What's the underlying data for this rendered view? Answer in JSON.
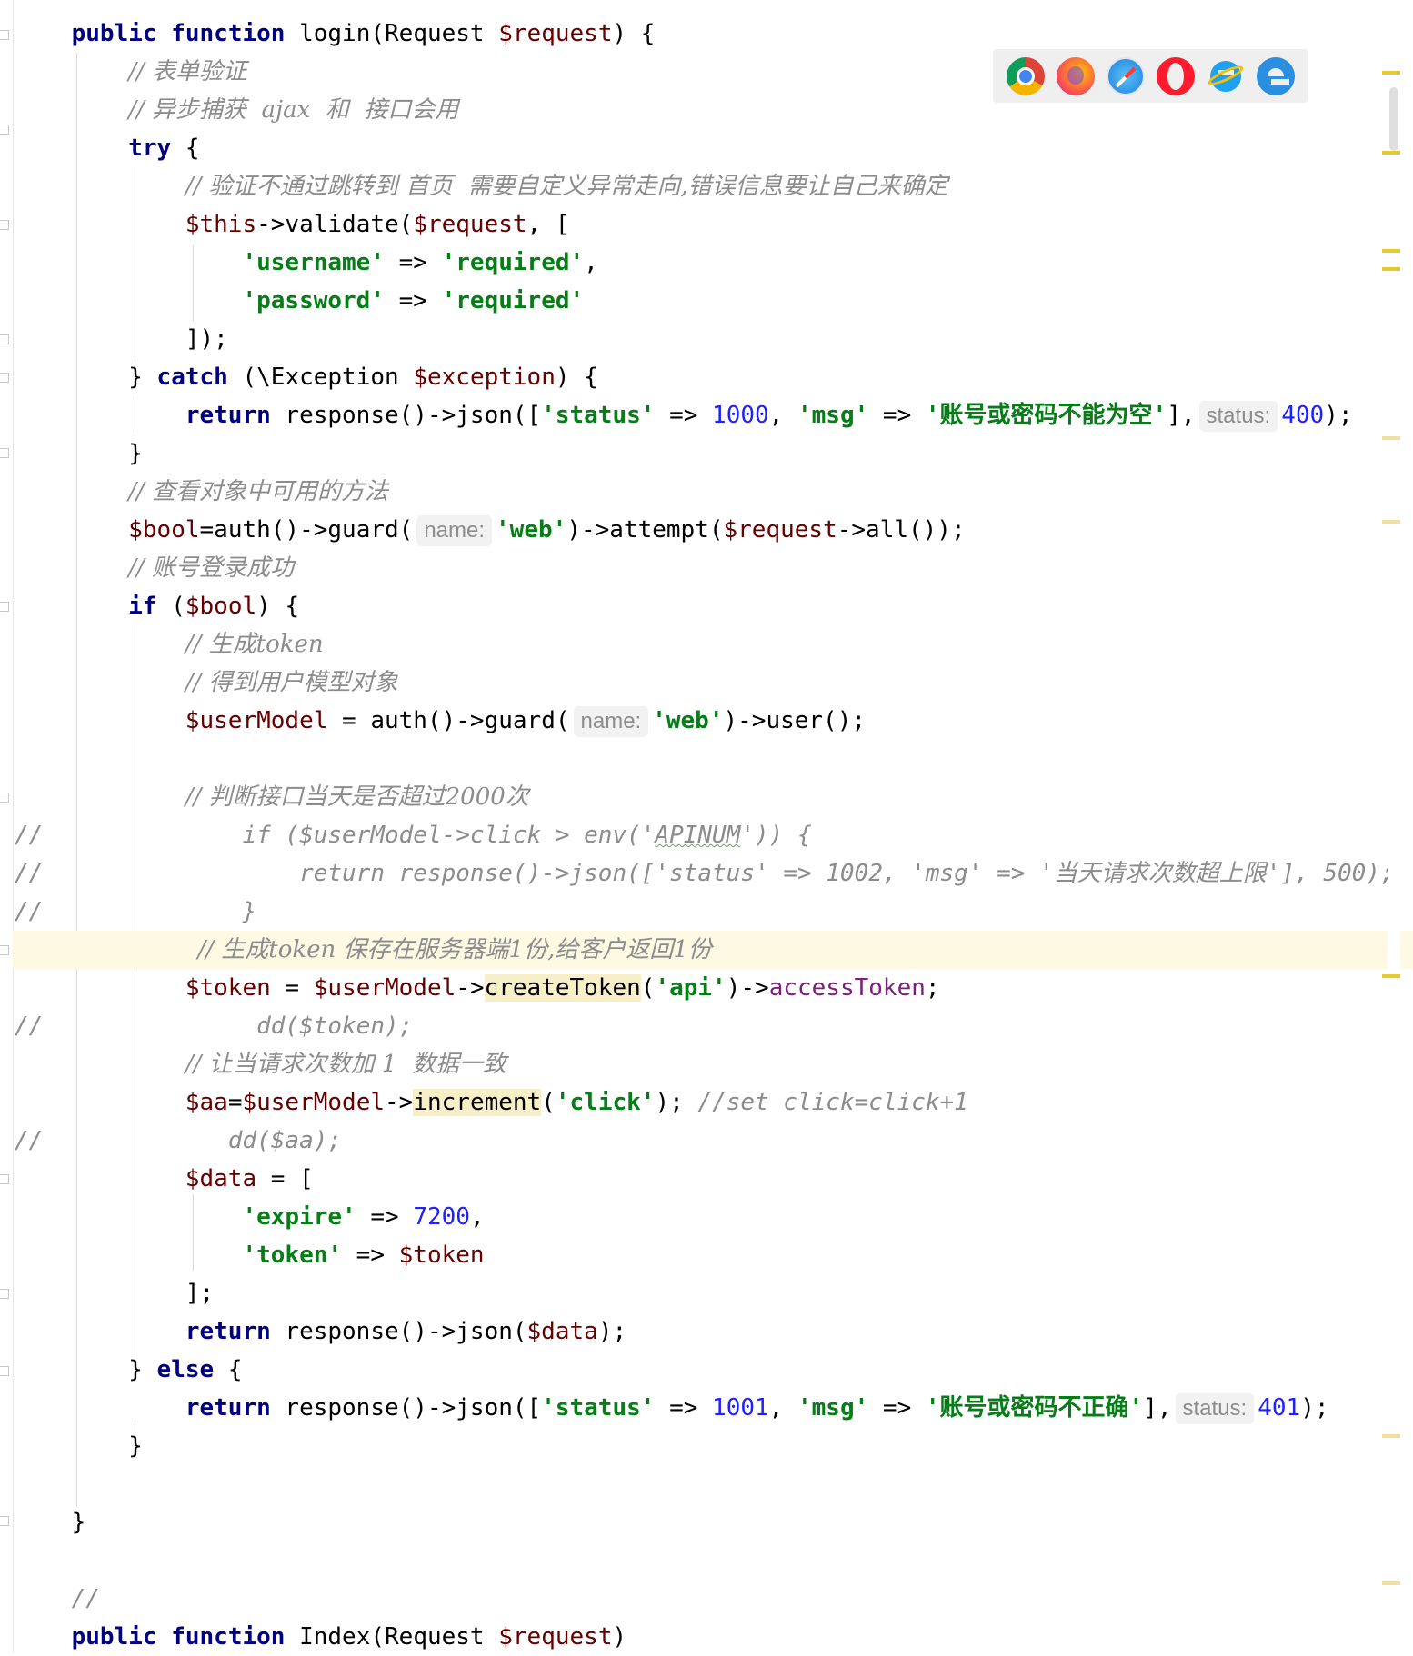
{
  "code": {
    "l_login_sig": [
      "public",
      "function",
      "login(Request ",
      "$request",
      ") {"
    ],
    "c_form_validate": "// 表单验证",
    "c_async": "// 异步捕获  ajax  和  接口会用",
    "try_kw": "try",
    "brace_open": " {",
    "c_validate_fail": "// 验证不通过跳转到 首页  需要自定义异常走向,错误信息要让自己来确定",
    "validate_call": [
      "$this",
      "->validate(",
      "$request",
      ", ["
    ],
    "rule_username": [
      "'username'",
      " => ",
      "'required'",
      ","
    ],
    "rule_password": [
      "'password'",
      " => ",
      "'required'"
    ],
    "validate_close": "]);",
    "catch_line": [
      "} ",
      "catch",
      " (\\Exception ",
      "$exception",
      ") {"
    ],
    "return1": [
      "return",
      " response()->json([",
      "'status'",
      " => ",
      "1000",
      ", ",
      "'msg'",
      " => ",
      "'账号或密码不能为空'",
      "],",
      "status:",
      "400",
      ");"
    ],
    "brace_close": "}",
    "c_methods": "// 查看对象中可用的方法",
    "bool_line": [
      "$bool",
      "=auth()->guard(",
      "name:",
      "'web'",
      ")->attempt(",
      "$request",
      "->all());"
    ],
    "c_login_ok": "// 账号登录成功",
    "if_line": [
      "if",
      " (",
      "$bool",
      ") {"
    ],
    "c_gen_token": "// 生成token",
    "c_get_user": "// 得到用户模型对象",
    "usermodel_line": [
      "$userModel",
      " = auth()->guard(",
      "name:",
      "'web'",
      ")->user();"
    ],
    "c_check_2000": "// 判断接口当天是否超过2000次",
    "cm_if": [
      "//",
      "if ($userModel->click > env('",
      "APINUM",
      "')) {"
    ],
    "cm_return": [
      "//",
      "return response()->json(['status' => 1002, 'msg' => '当天请求次数超上限'], 500);"
    ],
    "cm_close": [
      "//",
      "}"
    ],
    "c_save_token": "// 生成token 保存在服务器端1份,给客户返回1份",
    "token_line": [
      "$token",
      " = ",
      "$userModel",
      "->",
      "createToken",
      "(",
      "'api'",
      ")->",
      "accessToken",
      ";"
    ],
    "cm_dd_token": [
      "//",
      "dd($token);"
    ],
    "c_increment": "// 让当请求次数加 1  数据一致",
    "aa_line": [
      "$aa",
      "=",
      "$userModel",
      "->",
      "increment",
      "(",
      "'click'",
      ");",
      "//set click=click+1"
    ],
    "cm_dd_aa": [
      "//",
      "dd($aa);"
    ],
    "data_line": [
      "$data",
      " = ["
    ],
    "expire_line": [
      "'expire'",
      " => ",
      "7200",
      ","
    ],
    "token_item": [
      "'token'",
      " => ",
      "$token"
    ],
    "arr_close": "];",
    "return_data": [
      "return",
      " response()->json(",
      "$data",
      ");"
    ],
    "else_line": [
      "} ",
      "else",
      " {"
    ],
    "return2": [
      "return",
      " response()->json([",
      "'status'",
      " => ",
      "1001",
      ", ",
      "'msg'",
      " => ",
      "'账号或密码不正确'",
      "],",
      "status:",
      "401",
      ");"
    ],
    "c_empty": "//",
    "index_sig": [
      "public",
      "function",
      "Index(Request ",
      "$request",
      ")"
    ]
  },
  "browsers": [
    "chrome-icon",
    "firefox-icon",
    "safari-icon",
    "opera-icon",
    "ie-icon",
    "edge-icon"
  ],
  "colors": {
    "keyword": "#000080",
    "variable": "#660000",
    "string": "#067d17",
    "number": "#1f1fff",
    "comment": "#8c8c8c",
    "current_line": "#fdf9e3",
    "usage_highlight": "#f7efc8",
    "marker": "#e8c92e"
  }
}
